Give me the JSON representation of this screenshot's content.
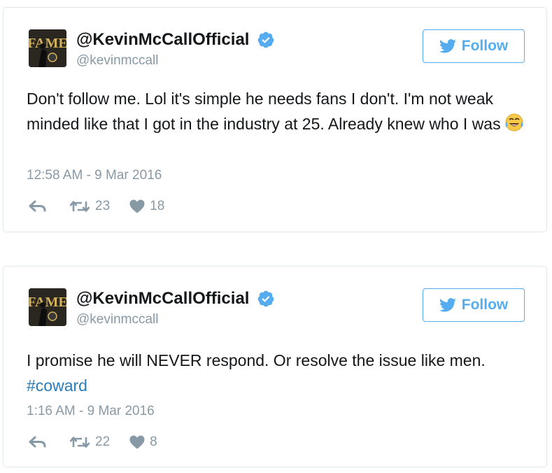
{
  "colors": {
    "accent": "#55acee",
    "hashtag": "#2b7bb9",
    "muted": "#8899a6",
    "text": "#14171a",
    "border": "#e1e8ed"
  },
  "tweets": [
    {
      "author": {
        "display_name": "@KevinMcCallOfficial",
        "screen_name": "@kevinmccall",
        "verified": true,
        "avatar_text": "FAME"
      },
      "follow_label": "Follow",
      "text": "Don't follow me. Lol it's simple he needs fans I don't. I'm not weak minded like that I got in the industry at 25. Already knew who I was",
      "emoji": "face-with-tears-of-joy",
      "timestamp": "12:58 AM - 9 Mar 2016",
      "retweets": "23",
      "likes": "18"
    },
    {
      "author": {
        "display_name": "@KevinMcCallOfficial",
        "screen_name": "@kevinmccall",
        "verified": true,
        "avatar_text": "FAME"
      },
      "follow_label": "Follow",
      "text": "I promise he will NEVER respond. Or resolve the issue like men.",
      "hashtag": "#coward",
      "timestamp": "1:16 AM - 9 Mar 2016",
      "retweets": "22",
      "likes": "8"
    }
  ]
}
